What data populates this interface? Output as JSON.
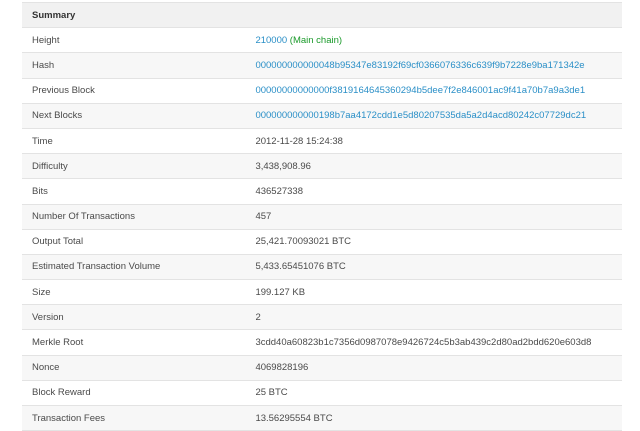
{
  "summary": {
    "header": "Summary",
    "rows": [
      {
        "label": "Height",
        "value": "210000",
        "suffix": "(Main chain)",
        "link": true
      },
      {
        "label": "Hash",
        "value": "000000000000048b95347e83192f69cf0366076336c639f9b7228e9ba171342e",
        "link": true
      },
      {
        "label": "Previous Block",
        "value": "00000000000000f3819164645360294b5dee7f2e846001ac9f41a70b7a9a3de1",
        "link": true
      },
      {
        "label": "Next Blocks",
        "value": "000000000000198b7aa4172cdd1e5d80207535da5a2d4acd80242c07729dc21",
        "link": true
      },
      {
        "label": "Time",
        "value": "2012-11-28 15:24:38",
        "link": false
      },
      {
        "label": "Difficulty",
        "value": "3,438,908.96",
        "link": false
      },
      {
        "label": "Bits",
        "value": "436527338",
        "link": false
      },
      {
        "label": "Number Of Transactions",
        "value": "457",
        "link": false
      },
      {
        "label": "Output Total",
        "value": "25,421.70093021 BTC",
        "link": false
      },
      {
        "label": "Estimated Transaction Volume",
        "value": "5,433.65451076 BTC",
        "link": false
      },
      {
        "label": "Size",
        "value": "199.127 KB",
        "link": false
      },
      {
        "label": "Version",
        "value": "2",
        "link": false
      },
      {
        "label": "Merkle Root",
        "value": "3cdd40a60823b1c7356d0987078e9426724c5b3ab439c2d80ad2bdd620e603d8",
        "link": false
      },
      {
        "label": "Nonce",
        "value": "4069828196",
        "link": false
      },
      {
        "label": "Block Reward",
        "value": "25 BTC",
        "link": false
      },
      {
        "label": "Transaction Fees",
        "value": "13.56295554 BTC",
        "link": false
      }
    ]
  },
  "colors": {
    "link": "#2a8fc7",
    "main_chain": "#1a9a2a",
    "header_bg": "#f1f1f1",
    "border": "#e3e3e3"
  }
}
